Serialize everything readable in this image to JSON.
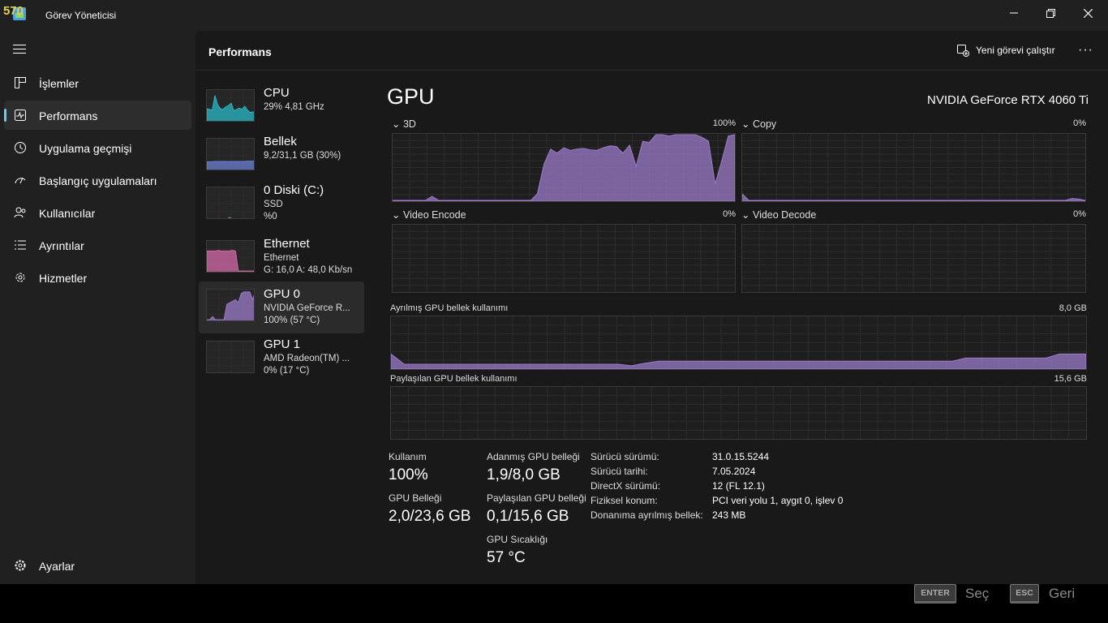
{
  "overlay": {
    "fps": "570"
  },
  "window": {
    "title": "Görev Yöneticisi"
  },
  "sidebar": {
    "items": [
      {
        "label": "İşlemler",
        "icon": "processes-icon"
      },
      {
        "label": "Performans",
        "icon": "performance-icon",
        "active": true
      },
      {
        "label": "Uygulama geçmişi",
        "icon": "history-icon"
      },
      {
        "label": "Başlangıç uygulamaları",
        "icon": "startup-icon"
      },
      {
        "label": "Kullanıcılar",
        "icon": "users-icon"
      },
      {
        "label": "Ayrıntılar",
        "icon": "details-icon"
      },
      {
        "label": "Hizmetler",
        "icon": "services-icon"
      }
    ],
    "settings_label": "Ayarlar"
  },
  "header": {
    "title": "Performans",
    "run_task_label": "Yeni görevi çalıştır",
    "more_label": "···"
  },
  "devices": [
    {
      "name": "CPU",
      "line2": "29%  4,81 GHz",
      "line3": "",
      "color": "#2ab7c6",
      "usage": [
        0.42,
        0.4,
        0.38,
        0.85,
        0.55,
        0.42,
        0.4,
        0.48,
        0.52,
        0.6,
        0.35,
        0.4,
        0.44,
        0.4,
        0.5,
        0.38,
        0.3,
        0.32,
        0.28
      ]
    },
    {
      "name": "Bellek",
      "line2": "9,2/31,1 GB (30%)",
      "line3": "",
      "color": "#6a7fd1",
      "usage": [
        0.28,
        0.28,
        0.28,
        0.29,
        0.29,
        0.29,
        0.29,
        0.29,
        0.29,
        0.29,
        0.29,
        0.29,
        0.29,
        0.29,
        0.3,
        0.3,
        0.3,
        0.3
      ]
    },
    {
      "name": "0 Diski (C:)",
      "line2": "SSD",
      "line3": "%0",
      "color": "#4fa56e",
      "usage": [
        0,
        0,
        0,
        0,
        0,
        0,
        0,
        0,
        0.05,
        0,
        0,
        0,
        0,
        0,
        0,
        0,
        0,
        0
      ]
    },
    {
      "name": "Ethernet",
      "line2": "Ethernet",
      "line3": "G: 16,0  A: 48,0 Kb/sn",
      "color": "#d46aa7",
      "usage": [
        0.7,
        0.7,
        0.7,
        0.7,
        0.72,
        0.7,
        0.7,
        0.7,
        0.7,
        0.72,
        0.7,
        0.05,
        0.05,
        0.05,
        0.05,
        0.05,
        0.05,
        0.05
      ]
    },
    {
      "name": "GPU 0",
      "line2": "NVIDIA GeForce R...",
      "line3": "100%  (57 °C)",
      "color": "#9b7bc9",
      "active": true,
      "usage": [
        0.05,
        0.05,
        0.15,
        0.05,
        0.05,
        0.05,
        0.05,
        0.55,
        0.6,
        0.65,
        0.7,
        0.6,
        0.9,
        0.95,
        0.95,
        0.95,
        0.7,
        0.98
      ]
    },
    {
      "name": "GPU 1",
      "line2": "AMD Radeon(TM) ...",
      "line3": "0%  (17 °C)",
      "color": "#9b7bc9",
      "usage": [
        0,
        0,
        0,
        0,
        0,
        0,
        0,
        0,
        0,
        0,
        0,
        0,
        0,
        0,
        0,
        0,
        0,
        0
      ]
    }
  ],
  "gpu": {
    "title": "GPU",
    "model": "NVIDIA GeForce RTX 4060 Ti",
    "engines": [
      {
        "label": "3D",
        "pct": "100%",
        "usage": [
          0,
          0,
          0,
          0,
          0,
          0,
          0.06,
          0,
          0,
          0,
          0,
          0,
          0,
          0,
          0,
          0,
          0,
          0,
          0,
          0,
          0,
          0,
          0.1,
          0.55,
          0.78,
          0.72,
          0.8,
          0.76,
          0.78,
          0.79,
          0.77,
          0.76,
          0.8,
          0.83,
          0.82,
          0.72,
          0.84,
          0.52,
          0.9,
          0.88,
          1.0,
          1.0,
          0.98,
          1.0,
          1.0,
          1.0,
          1.0,
          0.96,
          0.9,
          0.25,
          0.6,
          0.98,
          1.0
        ]
      },
      {
        "label": "Copy",
        "pct": "0%",
        "usage": [
          0.1,
          0,
          0,
          0,
          0,
          0,
          0,
          0,
          0,
          0,
          0,
          0,
          0,
          0,
          0,
          0,
          0,
          0,
          0,
          0,
          0,
          0,
          0,
          0,
          0,
          0,
          0,
          0,
          0,
          0,
          0,
          0,
          0,
          0,
          0,
          0,
          0,
          0,
          0,
          0,
          0,
          0,
          0,
          0,
          0,
          0,
          0,
          0,
          0,
          0,
          0.03,
          0.02,
          0
        ]
      },
      {
        "label": "Video Encode",
        "pct": "0%",
        "usage": []
      },
      {
        "label": "Video Decode",
        "pct": "0%",
        "usage": []
      }
    ],
    "dedicated_mem": {
      "label": "Ayrılmış GPU bellek kullanımı",
      "max": "8,0 GB",
      "usage": [
        0.28,
        0.08,
        0.08,
        0.08,
        0.08,
        0.08,
        0.08,
        0.08,
        0.08,
        0.08,
        0.08,
        0.08,
        0.08,
        0.08,
        0.08,
        0.08,
        0.08,
        0.08,
        0.05,
        0.1,
        0.14,
        0.14,
        0.14,
        0.14,
        0.14,
        0.14,
        0.14,
        0.14,
        0.14,
        0.14,
        0.14,
        0.14,
        0.14,
        0.14,
        0.14,
        0.14,
        0.14,
        0.14,
        0.14,
        0.14,
        0.14,
        0.14,
        0.14,
        0.2,
        0.2,
        0.2,
        0.2,
        0.2,
        0.2,
        0.2,
        0.28,
        0.28,
        0.28
      ]
    },
    "shared_mem": {
      "label": "Paylaşılan GPU bellek kullanımı",
      "max": "15,6 GB",
      "usage": []
    },
    "stats": {
      "usage_label": "Kullanım",
      "usage_value": "100%",
      "gpu_mem_label": "GPU Belleği",
      "gpu_mem_value": "2,0/23,6 GB",
      "dedicated_label": "Adanmış GPU belleği",
      "dedicated_value": "1,9/8,0 GB",
      "shared_label": "Paylaşılan GPU belleği",
      "shared_value": "0,1/15,6 GB",
      "temp_label": "GPU Sıcaklığı",
      "temp_value": "57 °C"
    },
    "info": [
      {
        "k": "Sürücü sürümü:",
        "v": "31.0.15.5244"
      },
      {
        "k": "Sürücü tarihi:",
        "v": "7.05.2024"
      },
      {
        "k": "DirectX sürümü:",
        "v": "12 (FL 12.1)"
      },
      {
        "k": "Fiziksel konum:",
        "v": "PCI veri yolu 1, aygıt 0, işlev 0"
      },
      {
        "k": "Donanıma ayrılmış bellek:",
        "v": "243 MB"
      }
    ]
  },
  "footer": {
    "enter_key": "ENTER",
    "enter_label": "Seç",
    "esc_key": "ESC",
    "esc_label": "Geri"
  },
  "colors": {
    "accent": "#60cdff",
    "gpu": "#9b7bc9"
  }
}
